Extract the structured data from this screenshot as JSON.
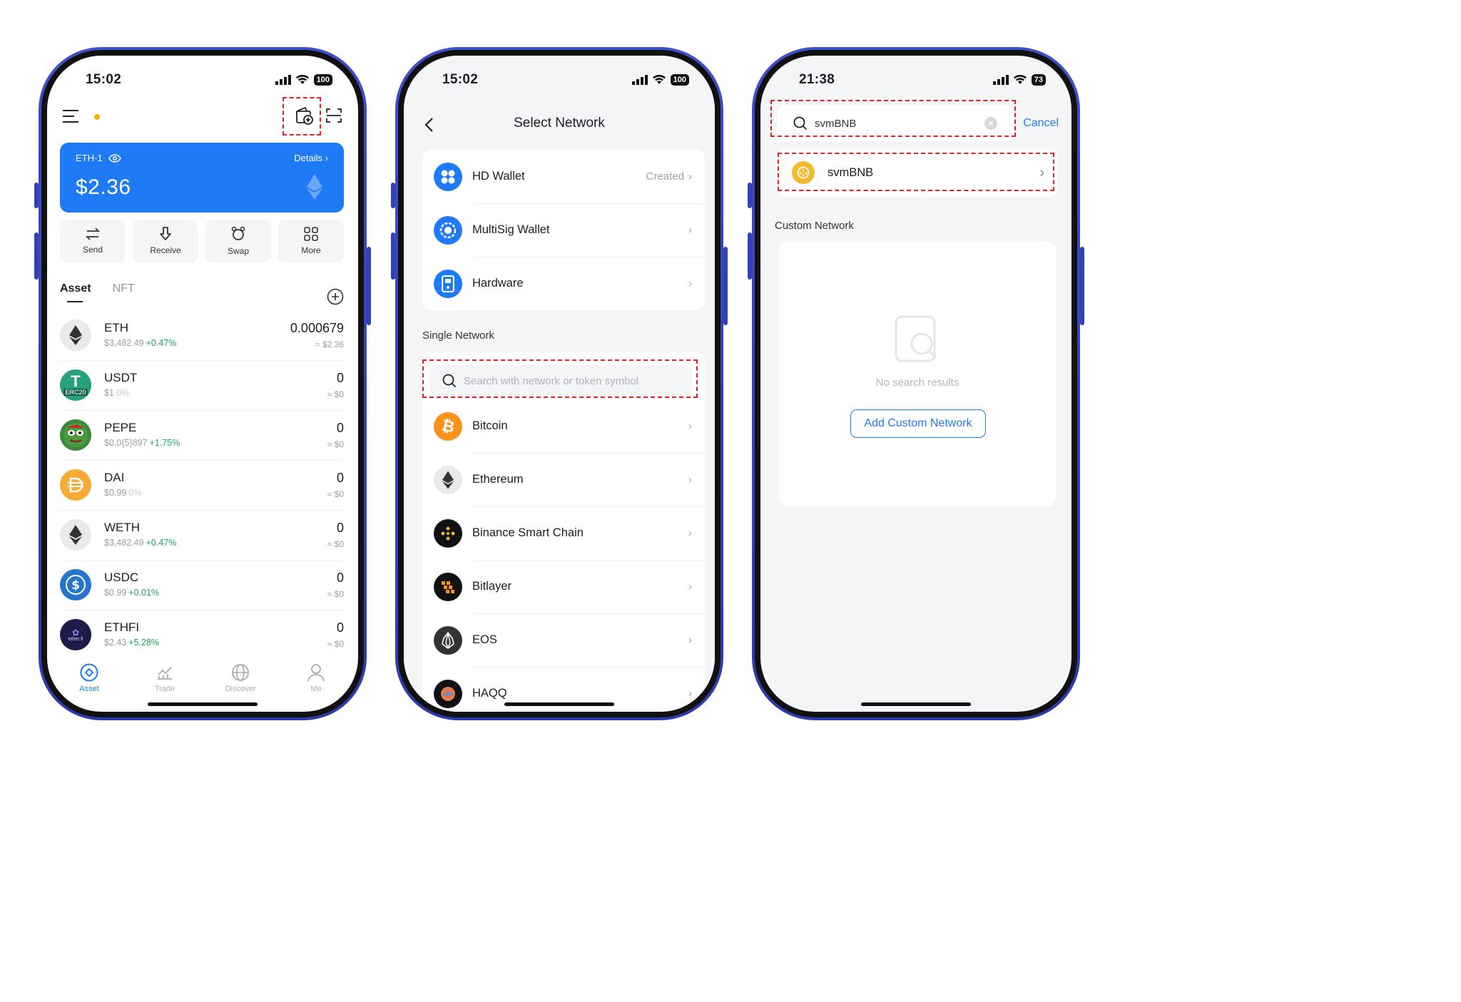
{
  "screen1": {
    "time": "15:02",
    "battery": "100",
    "account": {
      "name": "ETH-1",
      "details": "Details",
      "balance": "$2.36"
    },
    "actions": [
      {
        "label": "Send",
        "icon": "send-icon"
      },
      {
        "label": "Receive",
        "icon": "receive-icon"
      },
      {
        "label": "Swap",
        "icon": "swap-icon"
      },
      {
        "label": "More",
        "icon": "more-icon"
      }
    ],
    "tabs": {
      "asset": "Asset",
      "nft": "NFT"
    },
    "assets": [
      {
        "symbol": "ETH",
        "price": "$3,482.49",
        "change": "+0.47%",
        "amount": "0.000679",
        "value": "≈ $2.36"
      },
      {
        "symbol": "USDT",
        "price": "$1",
        "change": "0%",
        "amount": "0",
        "value": "≈ $0",
        "tag": "ERC20"
      },
      {
        "symbol": "PEPE",
        "price": "$0.0{5}897",
        "change": "+1.75%",
        "amount": "0",
        "value": "≈ $0"
      },
      {
        "symbol": "DAI",
        "price": "$0.99",
        "change": "0%",
        "amount": "0",
        "value": "≈ $0"
      },
      {
        "symbol": "WETH",
        "price": "$3,482.49",
        "change": "+0.47%",
        "amount": "0",
        "value": "≈ $0"
      },
      {
        "symbol": "USDC",
        "price": "$0.99",
        "change": "+0.01%",
        "amount": "0",
        "value": "≈ $0"
      },
      {
        "symbol": "ETHFI",
        "price": "$2.43",
        "change": "+5.28%",
        "amount": "0",
        "value": "≈ $0",
        "tag": "ether.fi"
      }
    ],
    "nav": [
      {
        "label": "Asset",
        "icon": "asset-icon"
      },
      {
        "label": "Trade",
        "icon": "trade-icon"
      },
      {
        "label": "Discover",
        "icon": "discover-icon"
      },
      {
        "label": "Me",
        "icon": "me-icon"
      }
    ]
  },
  "screen2": {
    "time": "15:02",
    "battery": "100",
    "title": "Select Network",
    "wallets": [
      {
        "label": "HD Wallet",
        "status": "Created"
      },
      {
        "label": "MultiSig Wallet"
      },
      {
        "label": "Hardware"
      }
    ],
    "single_network_label": "Single Network",
    "search_placeholder": "Search with network or token symbol",
    "networks": [
      "Bitcoin",
      "Ethereum",
      "Binance Smart Chain",
      "Bitlayer",
      "EOS",
      "HAQQ"
    ]
  },
  "screen3": {
    "time": "21:38",
    "battery": "73",
    "search_value": "svmBNB",
    "cancel": "Cancel",
    "result": "svmBNB",
    "custom_network_label": "Custom Network",
    "empty_text": "No search results",
    "add_button": "Add Custom Network"
  },
  "colors": {
    "primary": "#1f7af5",
    "positive": "#1aa35a",
    "highlight": "#d8232a",
    "phone_frame": "#3441b4"
  }
}
